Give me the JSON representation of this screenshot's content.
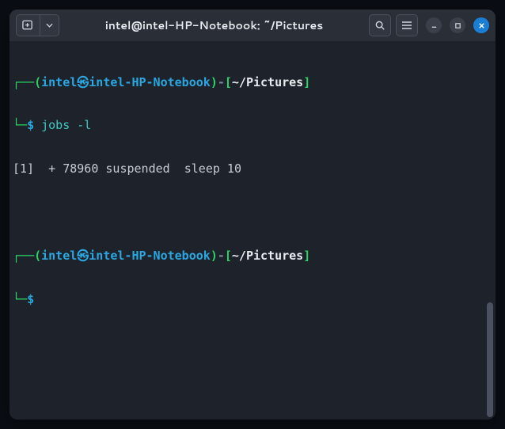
{
  "titlebar": {
    "title": "intel@intel-HP-Notebook: ~/Pictures"
  },
  "prompt": {
    "open_corner": "┌──",
    "paren_open": "(",
    "user": "intel",
    "separator_icon": "㉿",
    "host": "intel-HP-Notebook",
    "paren_close": ")",
    "dash": "-",
    "bracket_open": "[",
    "path": "~/Pictures",
    "bracket_close": "]",
    "lower_corner": "└─",
    "dollar": "$"
  },
  "cmd1": "jobs -l",
  "output1": {
    "jobnum": "[1]",
    "plus": "+",
    "pid": "78960",
    "state": "suspended",
    "cmd": "sleep 10"
  },
  "cmd2": ""
}
